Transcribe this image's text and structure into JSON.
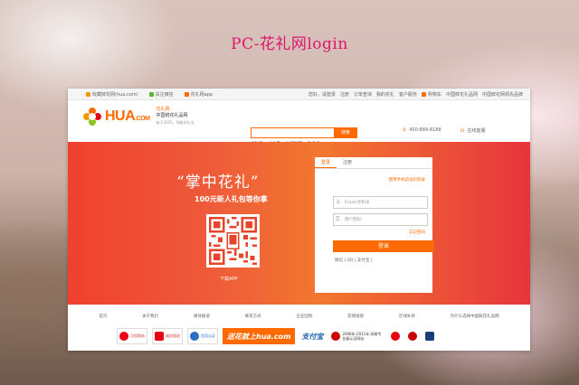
{
  "caption": "PC-花礼网login",
  "topbar": {
    "left": [
      "收藏鲜花网(hua.com)",
      "关注微信",
      "花礼网app"
    ],
    "right": [
      "您好，请登录",
      "注册",
      "订单查询",
      "我的花礼",
      "客户服务",
      "购物车",
      "中国鲜花礼品网",
      "中国鲜花网领先品牌"
    ]
  },
  "logo": {
    "brand": "HUA",
    "domain": ".COM",
    "cn_name": "花礼网",
    "tagline": "中国鲜花礼品网",
    "sub": "始于2005，领航花礼业"
  },
  "search": {
    "placeholder": "",
    "button": "搜索",
    "hotwords": [
      "红玫瑰",
      "永生花",
      "生日鲜花",
      "礼品卡"
    ]
  },
  "phone": "400-889-8188",
  "service": "在线客服",
  "hero": {
    "slogan": "“掌中花礼”",
    "subslogan": "100元新人礼包等你拿",
    "qr_label": "下载APP"
  },
  "login": {
    "tabs": [
      "登录",
      "注册"
    ],
    "phone_login": "使用手机验证码登录",
    "username_placeholder": "Email/手机号",
    "password_placeholder": "用户密码：",
    "forgot": "忘记密码",
    "submit": "登录",
    "social": "微信 | QQ | 支付宝 |"
  },
  "footer_nav": [
    "首页",
    "关于我们",
    "媒体报道",
    "联系方式",
    "企业团购",
    "友情链接",
    "在线补款",
    "为什么选择中国鲜花礼品网"
  ],
  "badges": {
    "b1": "可信网站",
    "b2": "诚信网站",
    "b3": "信用认证",
    "b4": "送花就上hua.com",
    "b5": "支付宝",
    "b6": "2006年-2011年 网易专业级认证网站",
    "b7": "工商局",
    "b8": "公安",
    "b9": "BBB"
  },
  "colors": {
    "accent": "#ff6a00",
    "caption": "#e0156c",
    "hero_start": "#f0402e",
    "hero_end": "#e7343d"
  }
}
